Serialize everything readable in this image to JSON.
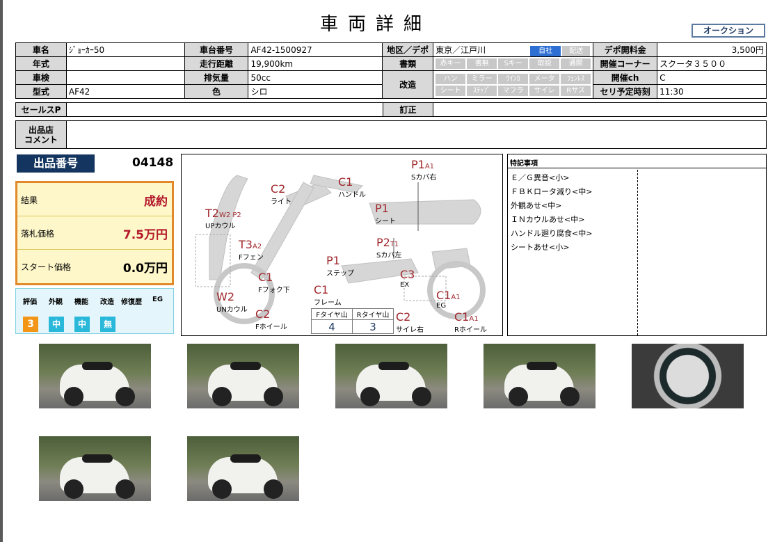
{
  "header": {
    "title": "車両詳細",
    "auction_label": "オークション"
  },
  "details": {
    "row1": {
      "name_label": "車名",
      "name_value": "ｼﾞｮｰｶｰ50",
      "frame_label": "車台番号",
      "frame_value": "AF42-1500927",
      "region_label": "地区／デポ",
      "region_value": "東京／江戸川",
      "opt_jisha": "自社",
      "opt_haisou": "配送",
      "fee_label": "デポ開料金",
      "fee_value": "3,500円"
    },
    "row2": {
      "year_label": "年式",
      "year_value": "",
      "mileage_label": "走行距離",
      "mileage_value": "19,900km",
      "docs_label": "書類",
      "docs_opts": [
        "赤キー",
        "書無",
        "Sキー",
        "取説",
        "通関"
      ],
      "corner_label": "開催コーナー",
      "corner_value": "スクータ３５００"
    },
    "row3": {
      "inspect_label": "車検",
      "inspect_value": "",
      "disp_label": "排気量",
      "disp_value": "50cc",
      "mod_label": "改造",
      "mod_opts_1": [
        "ハン",
        "ミラー",
        "ｳｲﾝｶ",
        "メータ",
        "ﾌｪﾝﾚｽ"
      ],
      "mod_opts_2": [
        "シート",
        "ｽﾃｯﾌﾟ",
        "マフラ",
        "サイレ",
        "Rサス"
      ],
      "ch_label": "開催ch",
      "ch_value": "C"
    },
    "row4": {
      "model_label": "型式",
      "model_value": "AF42",
      "color_label": "色",
      "color_value": "シロ",
      "time_label": "セリ予定時刻",
      "time_value": "11:30"
    },
    "sales_label": "セールスP",
    "sales_value": "",
    "correct_label": "訂正",
    "correct_value": "",
    "comment_label": "出品店\nコメント",
    "comment_value": ""
  },
  "lot": {
    "label": "出品番号",
    "number": "04148"
  },
  "result": {
    "result_label": "結果",
    "result_value": "成約",
    "price_label": "落札価格",
    "price_value": "7.5万円",
    "start_label": "スタート価格",
    "start_value": "0.0万円"
  },
  "evaluation": {
    "heads": [
      "評価",
      "外観",
      "機能",
      "改造",
      "修復歴",
      "EG"
    ],
    "values": [
      "3",
      "中",
      "中",
      "無"
    ]
  },
  "diagram": {
    "marks": [
      {
        "code": "P1",
        "sub": "A1",
        "part": "Sカバ右"
      },
      {
        "code": "C2",
        "sub": "",
        "part": "ライト"
      },
      {
        "code": "C1",
        "sub": "",
        "part": "ハンドル"
      },
      {
        "code": "T2",
        "sub": "W2 P2",
        "part": "UPカウル"
      },
      {
        "code": "P1",
        "sub": "",
        "part": "シート"
      },
      {
        "code": "T3",
        "sub": "A2",
        "part": "Fフェン"
      },
      {
        "code": "P2",
        "sub": "T1",
        "part": "Sカバ左"
      },
      {
        "code": "P1",
        "sub": "",
        "part": "ステップ"
      },
      {
        "code": "C1",
        "sub": "",
        "part": "Fフォク下"
      },
      {
        "code": "C3",
        "sub": "",
        "part": "EX"
      },
      {
        "code": "W2",
        "sub": "",
        "part": "UNカウル"
      },
      {
        "code": "C1",
        "sub": "",
        "part": "フレーム"
      },
      {
        "code": "C1",
        "sub": "A1",
        "part": "EG"
      },
      {
        "code": "C2",
        "sub": "",
        "part": "Fホイール"
      },
      {
        "code": "C2",
        "sub": "",
        "part": "サイレ右"
      },
      {
        "code": "C1",
        "sub": "A1",
        "part": "Rホイール"
      }
    ],
    "tires": {
      "front_label": "Fタイヤ山",
      "rear_label": "Rタイヤ山",
      "front_value": "4",
      "rear_value": "3"
    }
  },
  "notes": {
    "title": "特記事項",
    "items": [
      "Ｅ／Ｇ異音<小>",
      "ＦＢＫロータ減り<中>",
      "外観あせ<中>",
      "ＩＮカウルあせ<中>",
      "ハンドル廻り腐食<中>",
      "シートあせ<小>"
    ]
  },
  "photos": [
    "photo-1",
    "photo-2",
    "photo-3",
    "photo-4",
    "photo-5",
    "photo-6",
    "photo-7"
  ]
}
